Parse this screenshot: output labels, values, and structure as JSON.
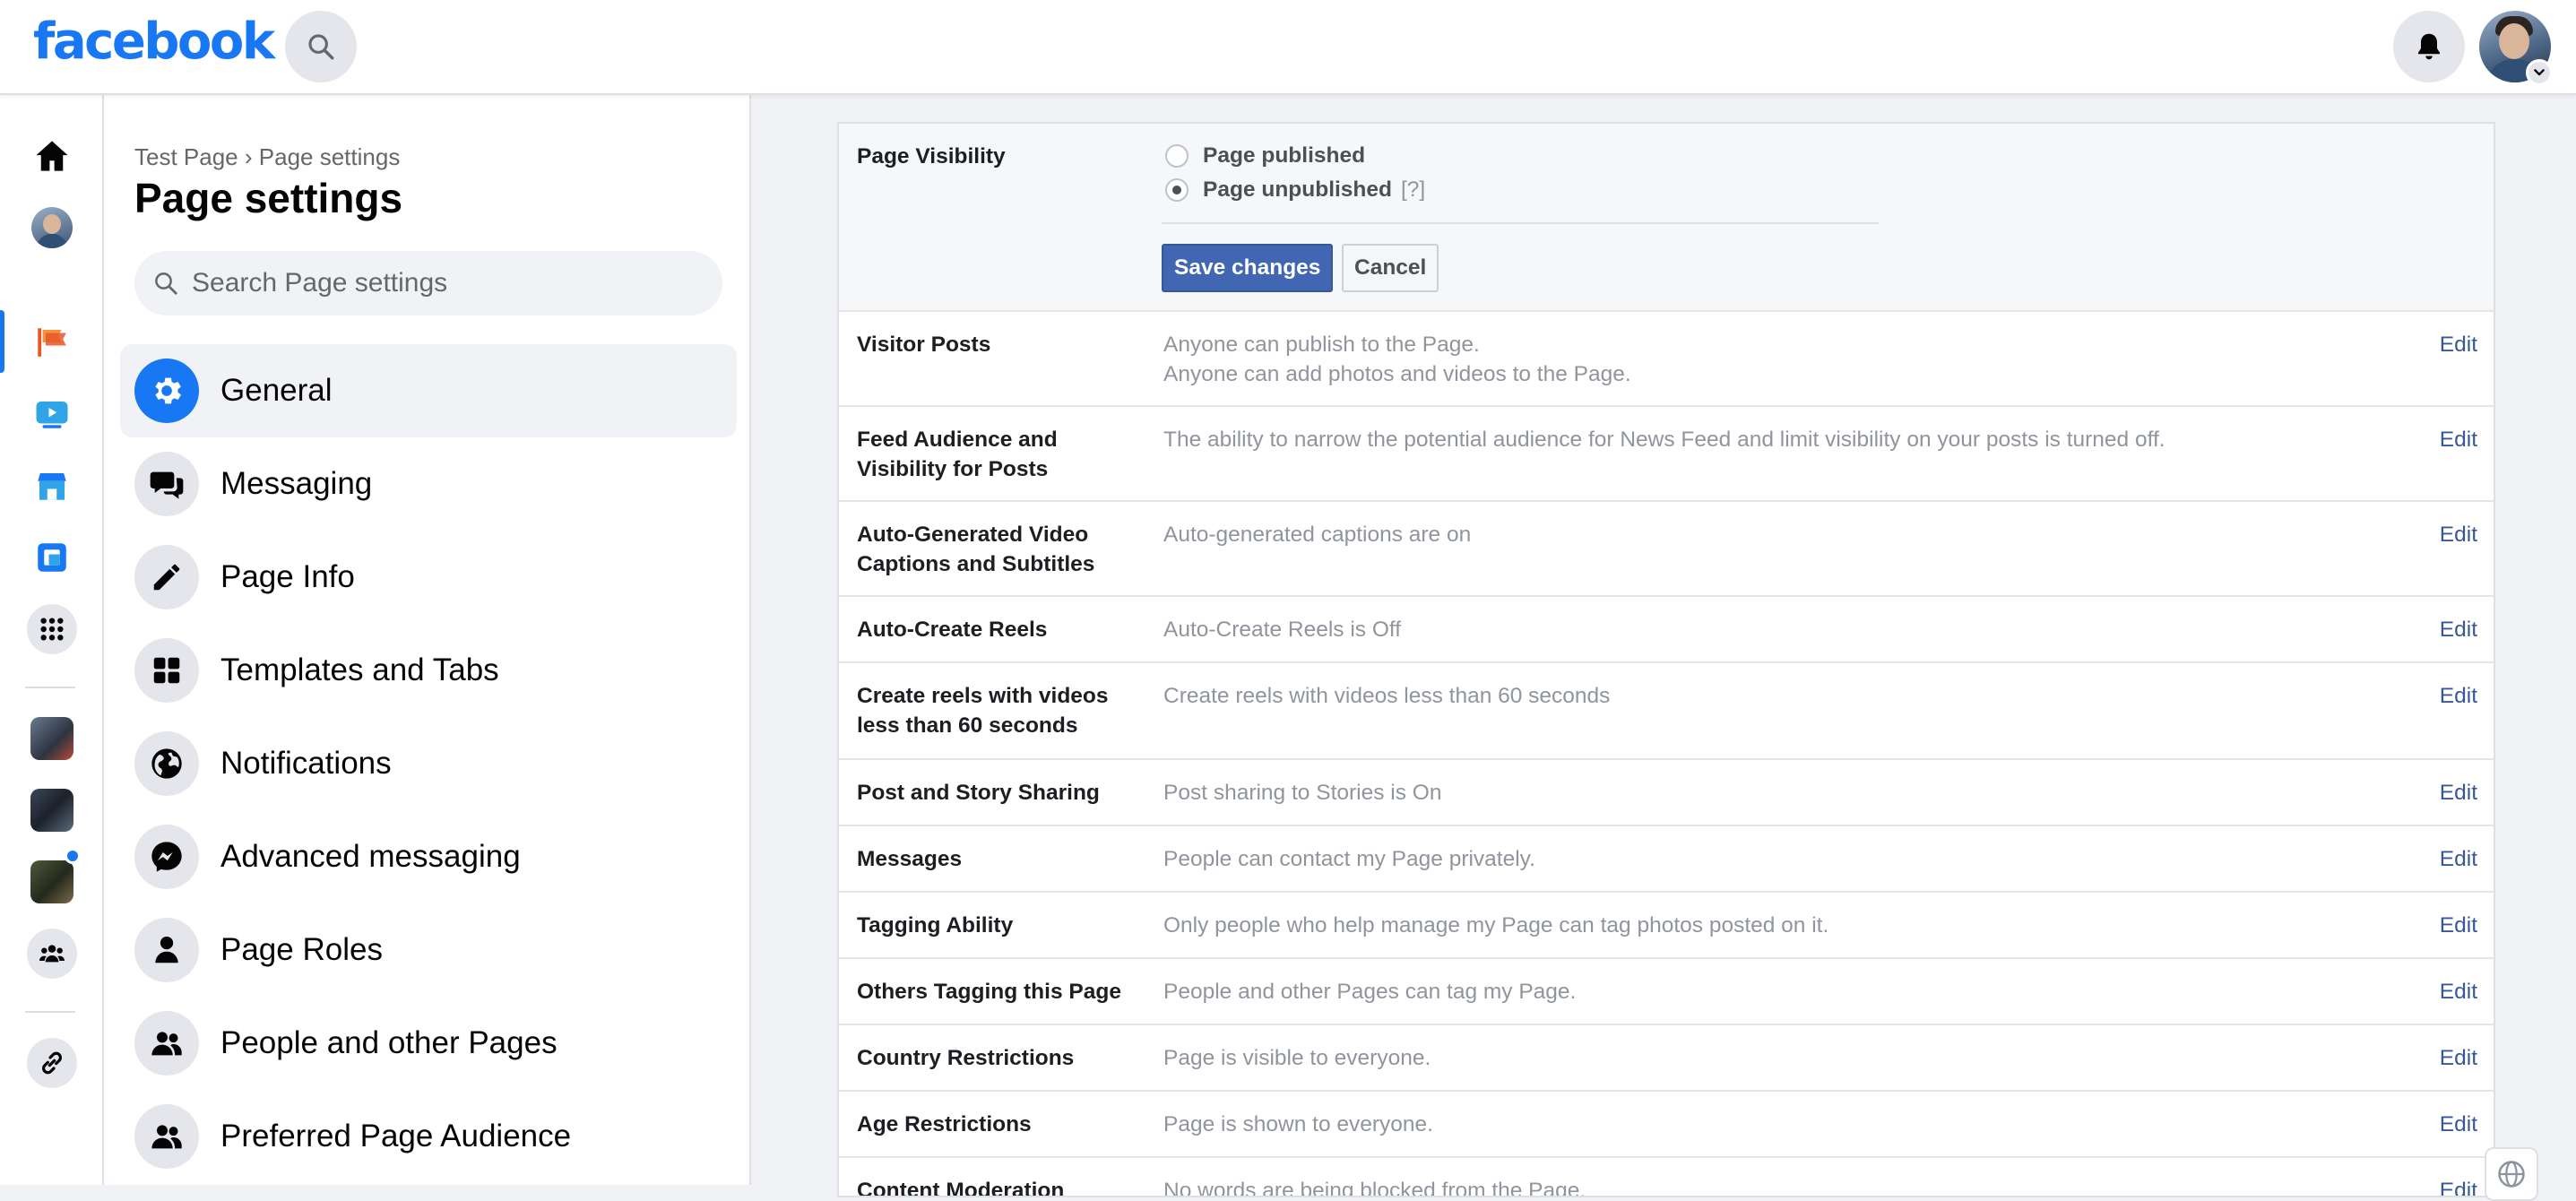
{
  "header": {
    "logo": "facebook"
  },
  "breadcrumb": {
    "page": "Test Page",
    "separator": "›",
    "current": "Page settings"
  },
  "sidebar": {
    "title": "Page settings",
    "search_placeholder": "Search Page settings",
    "items": [
      {
        "label": "General",
        "icon": "gear-icon",
        "active": true
      },
      {
        "label": "Messaging",
        "icon": "chat-bubbles-icon"
      },
      {
        "label": "Page Info",
        "icon": "pencil-icon"
      },
      {
        "label": "Templates and Tabs",
        "icon": "grid-icon"
      },
      {
        "label": "Notifications",
        "icon": "globe-icon"
      },
      {
        "label": "Advanced messaging",
        "icon": "messenger-icon"
      },
      {
        "label": "Page Roles",
        "icon": "person-icon"
      },
      {
        "label": "People and other Pages",
        "icon": "people-icon"
      },
      {
        "label": "Preferred Page Audience",
        "icon": "people-icon"
      }
    ]
  },
  "visibility": {
    "label": "Page Visibility",
    "options": [
      {
        "label": "Page published",
        "selected": false
      },
      {
        "label": "Page unpublished",
        "selected": true,
        "help": "[?]"
      }
    ],
    "save_label": "Save changes",
    "cancel_label": "Cancel"
  },
  "settings": {
    "edit_label": "Edit",
    "rows": [
      {
        "label": "Visitor Posts",
        "values": [
          "Anyone can publish to the Page.",
          "Anyone can add photos and videos to the Page."
        ]
      },
      {
        "label": "Feed Audience and Visibility for Posts",
        "values": [
          "The ability to narrow the potential audience for News Feed and limit visibility on your posts is turned off."
        ]
      },
      {
        "label": "Auto-Generated Video Captions and Subtitles",
        "values": [
          "Auto-generated captions are on"
        ]
      },
      {
        "label": "Auto-Create Reels",
        "values": [
          "Auto-Create Reels is Off"
        ]
      },
      {
        "label": "Create reels with videos less than 60 seconds",
        "values": [
          "Create reels with videos less than 60 seconds"
        ]
      },
      {
        "label": "Post and Story Sharing",
        "values": [
          "Post sharing to Stories is On"
        ]
      },
      {
        "label": "Messages",
        "values": [
          "People can contact my Page privately."
        ]
      },
      {
        "label": "Tagging Ability",
        "values": [
          "Only people who help manage my Page can tag photos posted on it."
        ]
      },
      {
        "label": "Others Tagging this Page",
        "values": [
          "People and other Pages can tag my Page."
        ]
      },
      {
        "label": "Country Restrictions",
        "values": [
          "Page is visible to everyone."
        ]
      },
      {
        "label": "Age Restrictions",
        "values": [
          "Page is shown to everyone."
        ]
      },
      {
        "label": "Content Moderation",
        "values": [
          "No words are being blocked from the Page."
        ]
      }
    ]
  },
  "colors": {
    "brand": "#1877f2",
    "save_button": "#4267b2",
    "link": "#365899"
  }
}
